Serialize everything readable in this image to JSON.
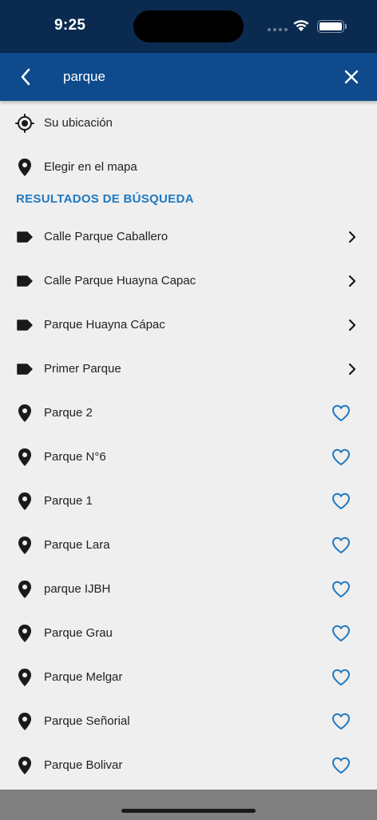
{
  "status_bar": {
    "time": "9:25"
  },
  "search": {
    "query": "parque"
  },
  "quick_actions": [
    {
      "label": "Su ubicación",
      "icon": "target-icon"
    },
    {
      "label": "Elegir en el mapa",
      "icon": "pin-icon"
    }
  ],
  "results_title": "RESULTADOS DE BÚSQUEDA",
  "streets": [
    {
      "label": "Calle Parque Caballero"
    },
    {
      "label": "Calle Parque Huayna Capac"
    },
    {
      "label": "Parque Huayna Cápac"
    },
    {
      "label": "Primer Parque"
    }
  ],
  "places": [
    {
      "label": "Parque 2"
    },
    {
      "label": "Parque N°6"
    },
    {
      "label": "Parque 1"
    },
    {
      "label": "Parque Lara"
    },
    {
      "label": "parque IJBH"
    },
    {
      "label": "Parque Grau"
    },
    {
      "label": "Parque Melgar"
    },
    {
      "label": "Parque Señorial"
    },
    {
      "label": "Parque Bolivar"
    }
  ],
  "colors": {
    "status_bar": "#0b2a4f",
    "header": "#0f4a8c",
    "accent": "#1f78c1",
    "background": "#efefef"
  }
}
